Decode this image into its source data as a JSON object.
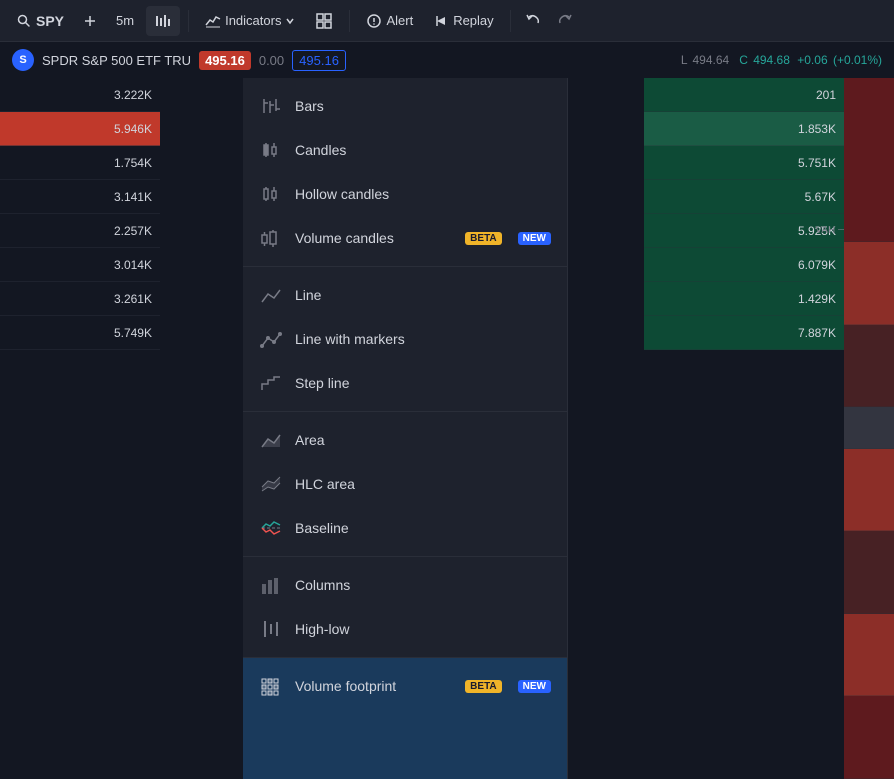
{
  "toolbar": {
    "symbol": "SPY",
    "timeframe": "5m",
    "add_label": "+",
    "indicators_label": "Indicators",
    "alert_label": "Alert",
    "replay_label": "Replay",
    "undo_label": "↶",
    "redo_label": "↷"
  },
  "price_bar": {
    "symbol_letter": "S",
    "symbol_name": "SPDR S&P 500 ETF TRU",
    "current_price": "495.16",
    "change": "0.00",
    "input_price": "495.16",
    "last_label": "L",
    "last_value": "494.64",
    "close_label": "C",
    "close_value": "494.68",
    "change_value": "+0.06",
    "change_pct": "(+0.01%)"
  },
  "data_rows": [
    {
      "value": "3.222K",
      "highlight": ""
    },
    {
      "value": "5.946K",
      "highlight": "red"
    },
    {
      "value": "1.754K",
      "highlight": ""
    },
    {
      "value": "3.141K",
      "highlight": ""
    },
    {
      "value": "2.257K",
      "highlight": ""
    },
    {
      "value": "3.014K",
      "highlight": ""
    },
    {
      "value": "3.261K",
      "highlight": ""
    },
    {
      "value": "5.749K",
      "highlight": ""
    }
  ],
  "right_rows": [
    {
      "value": "201",
      "highlight": "dark-green-bg"
    },
    {
      "value": "1.853K",
      "highlight": "green-bg"
    },
    {
      "value": "5.751K",
      "highlight": "dark-green-bg"
    },
    {
      "value": "5.67K",
      "highlight": "dark-green-bg"
    },
    {
      "value": "5.925K",
      "highlight": "dark-green-bg"
    },
    {
      "value": "6.079K",
      "highlight": "dark-green-bg"
    },
    {
      "value": "1.429K",
      "highlight": "dark-green-bg"
    },
    {
      "value": "7.887K",
      "highlight": "dark-green-bg"
    }
  ],
  "vah_label": "VAH ┄",
  "menu": {
    "sections": [
      {
        "items": [
          {
            "id": "bars",
            "label": "Bars",
            "icon": "bars-icon"
          },
          {
            "id": "candles",
            "label": "Candles",
            "icon": "candles-icon"
          },
          {
            "id": "hollow-candles",
            "label": "Hollow candles",
            "icon": "hollow-candles-icon"
          },
          {
            "id": "volume-candles",
            "label": "Volume candles",
            "icon": "volume-candles-icon",
            "badge_beta": "BETA",
            "badge_new": "NEW"
          }
        ]
      },
      {
        "items": [
          {
            "id": "line",
            "label": "Line",
            "icon": "line-icon"
          },
          {
            "id": "line-with-markers",
            "label": "Line with markers",
            "icon": "line-markers-icon"
          },
          {
            "id": "step-line",
            "label": "Step line",
            "icon": "step-line-icon"
          }
        ]
      },
      {
        "items": [
          {
            "id": "area",
            "label": "Area",
            "icon": "area-icon"
          },
          {
            "id": "hlc-area",
            "label": "HLC area",
            "icon": "hlc-area-icon"
          },
          {
            "id": "baseline",
            "label": "Baseline",
            "icon": "baseline-icon"
          }
        ]
      },
      {
        "items": [
          {
            "id": "columns",
            "label": "Columns",
            "icon": "columns-icon"
          },
          {
            "id": "high-low",
            "label": "High-low",
            "icon": "high-low-icon"
          }
        ]
      },
      {
        "items": [
          {
            "id": "volume-footprint",
            "label": "Volume footprint",
            "icon": "volume-footprint-icon",
            "badge_beta": "BETA",
            "badge_new": "NEW",
            "active": true
          }
        ]
      }
    ]
  }
}
